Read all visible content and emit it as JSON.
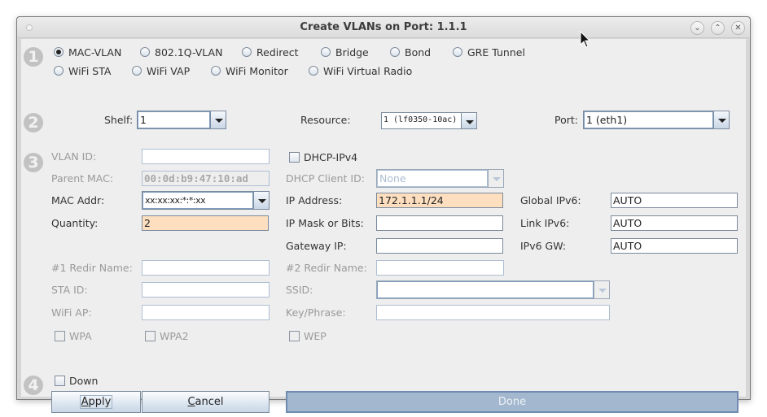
{
  "window": {
    "title": "Create VLANs on Port: 1.1.1",
    "controls": [
      "minimize",
      "maximize",
      "close"
    ]
  },
  "step_badges": [
    "1",
    "2",
    "3",
    "4"
  ],
  "section1": {
    "vlan_types_row1": [
      {
        "label": "MAC-VLAN",
        "selected": true
      },
      {
        "label": "802.1Q-VLAN",
        "selected": false
      },
      {
        "label": "Redirect",
        "selected": false
      },
      {
        "label": "Bridge",
        "selected": false
      },
      {
        "label": "Bond",
        "selected": false
      },
      {
        "label": "GRE Tunnel",
        "selected": false
      }
    ],
    "vlan_types_row2": [
      {
        "label": "WiFi STA",
        "selected": false
      },
      {
        "label": "WiFi VAP",
        "selected": false
      },
      {
        "label": "WiFi Monitor",
        "selected": false
      },
      {
        "label": "WiFi Virtual Radio",
        "selected": false
      }
    ]
  },
  "section2": {
    "shelf_label": "Shelf:",
    "shelf_value": "1",
    "resource_label": "Resource:",
    "resource_value": "1 (lf0350-10ac)",
    "port_label": "Port:",
    "port_value": "1 (eth1)"
  },
  "section3": {
    "vlan_id_label": "VLAN ID:",
    "vlan_id_value": "",
    "parent_mac_label": "Parent MAC:",
    "parent_mac_value": "00:0d:b9:47:10:ad",
    "mac_addr_label": "MAC Addr:",
    "mac_addr_value": "xx:xx:xx:*:*:xx",
    "quantity_label": "Quantity:",
    "quantity_value": "2",
    "dhcp_ipv4_label": "DHCP-IPv4",
    "dhcp_ipv4_checked": false,
    "dhcp_client_id_label": "DHCP Client ID:",
    "dhcp_client_id_value": "None",
    "ip_address_label": "IP Address:",
    "ip_address_value": "172.1.1.1/24",
    "ip_mask_label": "IP Mask or Bits:",
    "ip_mask_value": "",
    "gateway_ip_label": "Gateway IP:",
    "gateway_ip_value": "",
    "global_ipv6_label": "Global IPv6:",
    "global_ipv6_value": "AUTO",
    "link_ipv6_label": "Link IPv6:",
    "link_ipv6_value": "AUTO",
    "ipv6_gw_label": "IPv6 GW:",
    "ipv6_gw_value": "AUTO",
    "redir1_label": "#1 Redir Name:",
    "redir1_value": "",
    "redir2_label": "#2 Redir Name:",
    "redir2_value": "",
    "sta_id_label": "STA ID:",
    "sta_id_value": "",
    "ssid_label": "SSID:",
    "ssid_value": "",
    "wifi_ap_label": "WiFi AP:",
    "wifi_ap_value": "",
    "key_phrase_label": "Key/Phrase:",
    "key_phrase_value": "",
    "wpa_label": "WPA",
    "wpa2_label": "WPA2",
    "wep_label": "WEP"
  },
  "section4": {
    "down_label": "Down",
    "down_checked": false,
    "apply_prefix": "A",
    "apply_rest": "pply",
    "cancel_prefix": "C",
    "cancel_rest": "ancel",
    "done_label": "Done"
  }
}
